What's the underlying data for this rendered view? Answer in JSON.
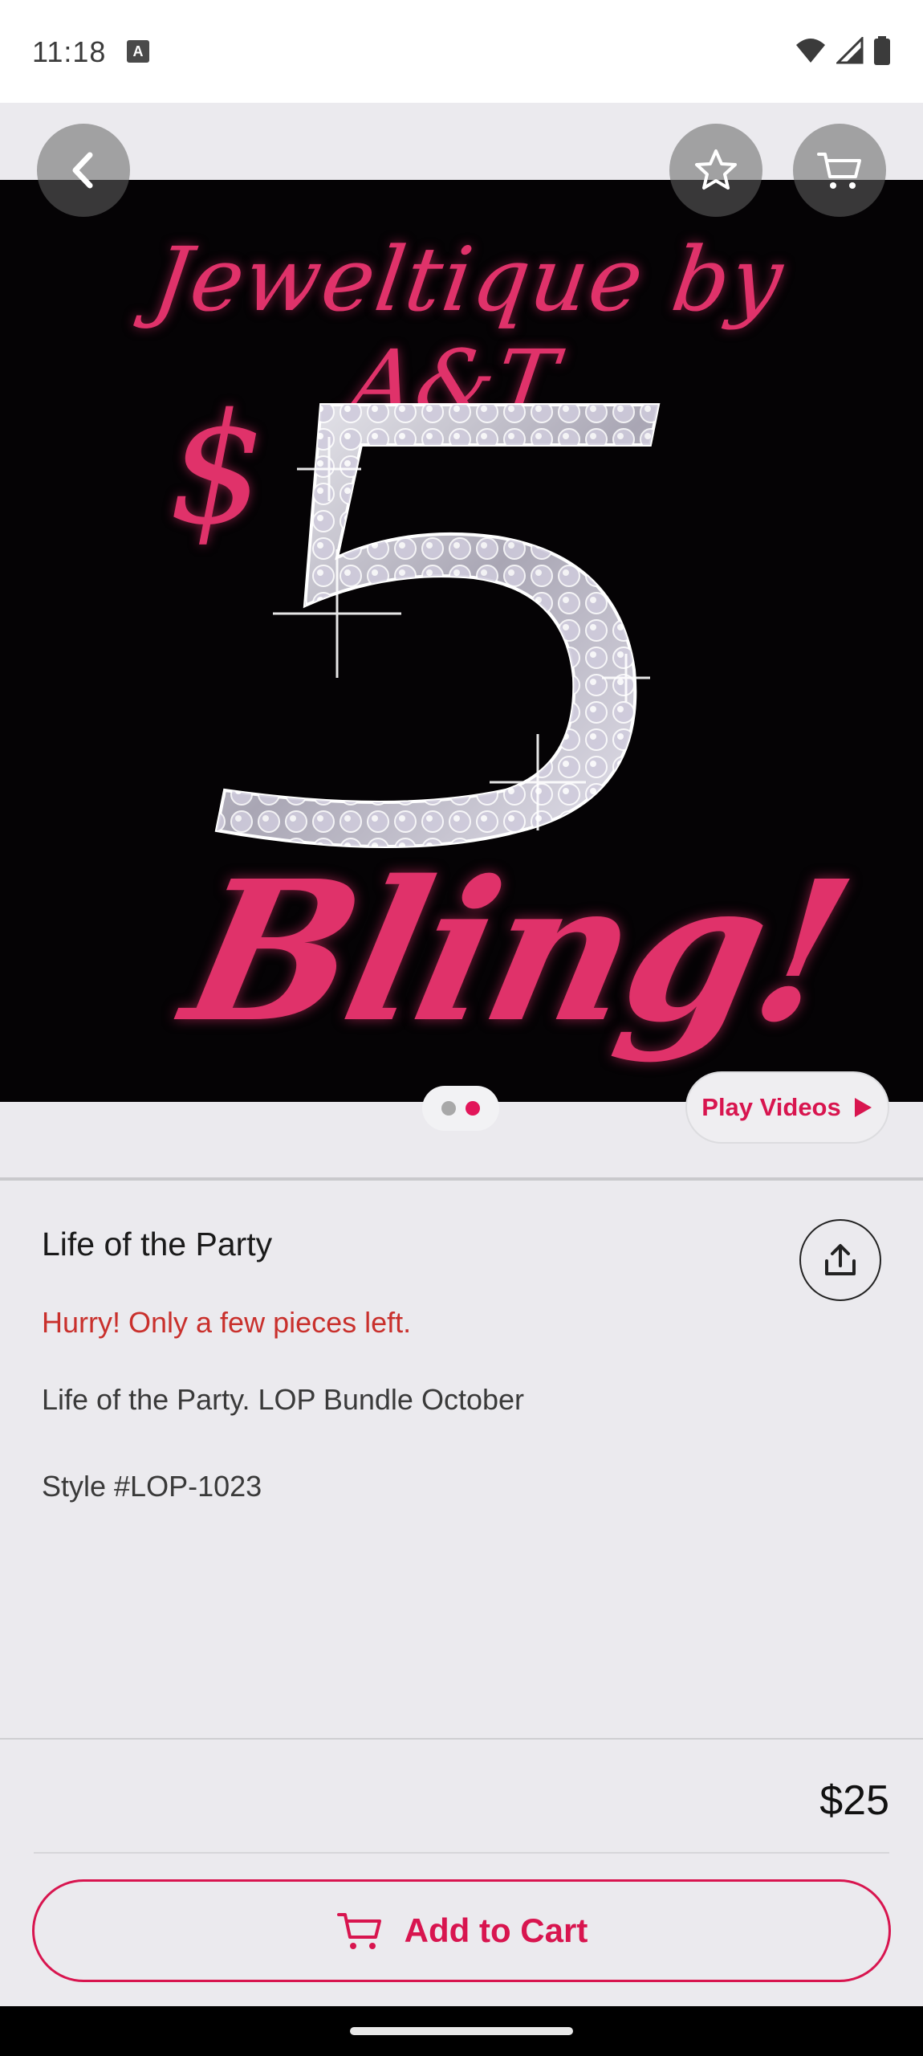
{
  "status_bar": {
    "time": "11:18",
    "a_icon_letter": "A",
    "icons": [
      "wifi-icon",
      "signal-icon",
      "battery-icon"
    ]
  },
  "hero": {
    "brand_text": "Jeweltique by A&T",
    "dollar_sign": "$",
    "five": "5",
    "bling_text": "Bling!",
    "pager": {
      "total": 2,
      "active_index": 1
    },
    "play_videos_label": "Play Videos"
  },
  "product": {
    "title": "Life of the Party",
    "urgency": "Hurry! Only a few pieces left.",
    "description": "Life of the Party. LOP Bundle October",
    "style": "Style #LOP-1023",
    "price": "$25"
  },
  "actions": {
    "add_to_cart_label": "Add to Cart"
  },
  "colors": {
    "accent": "#d8154f",
    "urgency": "#c9302c",
    "background": "#ebeaee"
  }
}
